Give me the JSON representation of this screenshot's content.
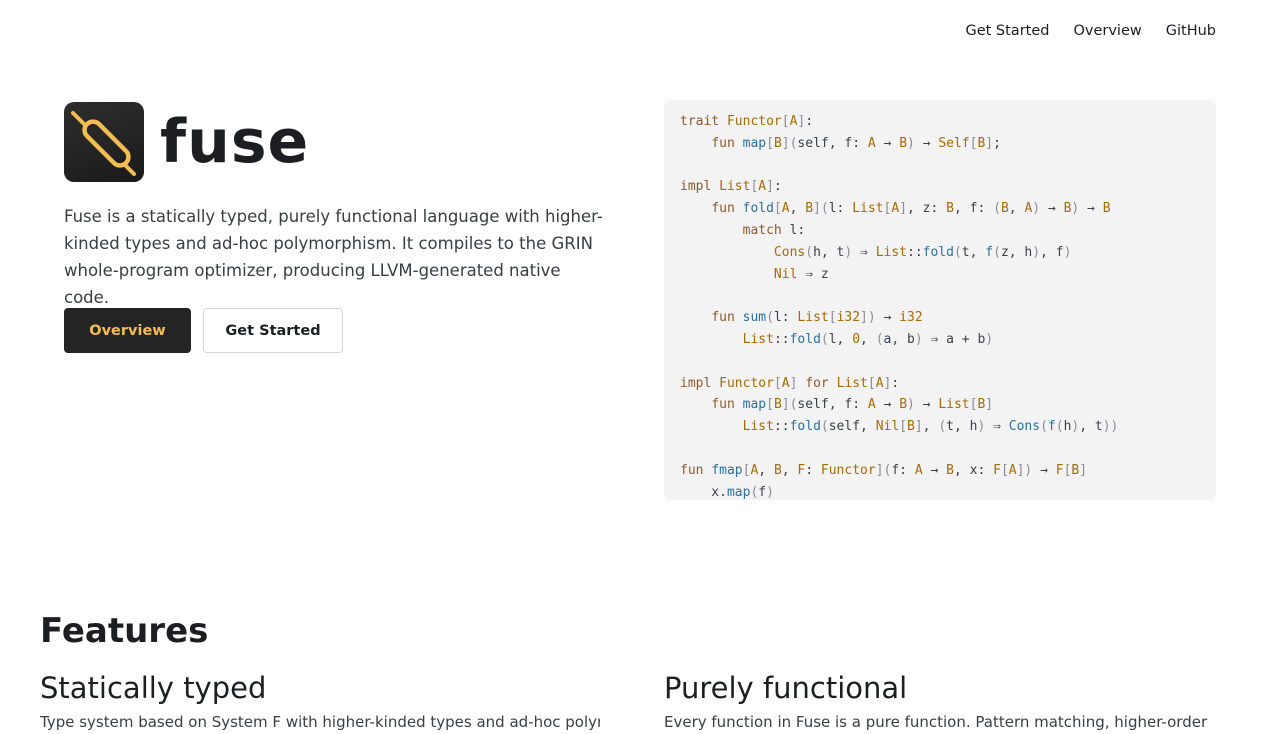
{
  "nav": {
    "items": [
      "Get Started",
      "Overview",
      "GitHub"
    ]
  },
  "hero": {
    "brand": "fuse",
    "description": "Fuse is a statically typed, purely functional language with higher-kinded types and ad-hoc polymorphism. It compiles to the GRIN whole-program optimizer, producing LLVM-generated native code.",
    "primary_button": "Overview",
    "secondary_button": "Get Started",
    "logo_icon": "fuse-logo-icon"
  },
  "code_sample": {
    "lines": [
      "trait Functor[A]:",
      "    fun map[B](self, f: A → B) → Self[B];",
      "",
      "impl List[A]:",
      "    fun fold[A, B](l: List[A], z: B, f: (B, A) → B) → B",
      "        match l:",
      "            Cons(h, t) ⇒ List::fold(t, f(z, h), f)",
      "            Nil ⇒ z",
      "",
      "    fun sum(l: List[i32]) → i32",
      "        List::fold(l, 0, (a, b) ⇒ a + b)",
      "",
      "impl Functor[A] for List[A]:",
      "    fun map[B](self, f: A → B) → List[B]",
      "        List::fold(self, Nil[B], (t, h) ⇒ Cons(f(h), t))",
      "",
      "fun fmap[A, B, F: Functor](f: A → B, x: F[A]) → F[B]",
      "    x.map(f)"
    ]
  },
  "features": {
    "heading": "Features",
    "items": [
      {
        "title": "Statically typed",
        "text": "Type system based on System F with higher-kinded types and ad-hoc polymorphism. Algebraic"
      },
      {
        "title": "Purely functional",
        "text": "Every function in Fuse is a pure function. Pattern matching, higher-order"
      }
    ]
  },
  "colors": {
    "accent": "#f2bd52",
    "dark": "#242424",
    "code_bg": "#f3f3f3"
  }
}
